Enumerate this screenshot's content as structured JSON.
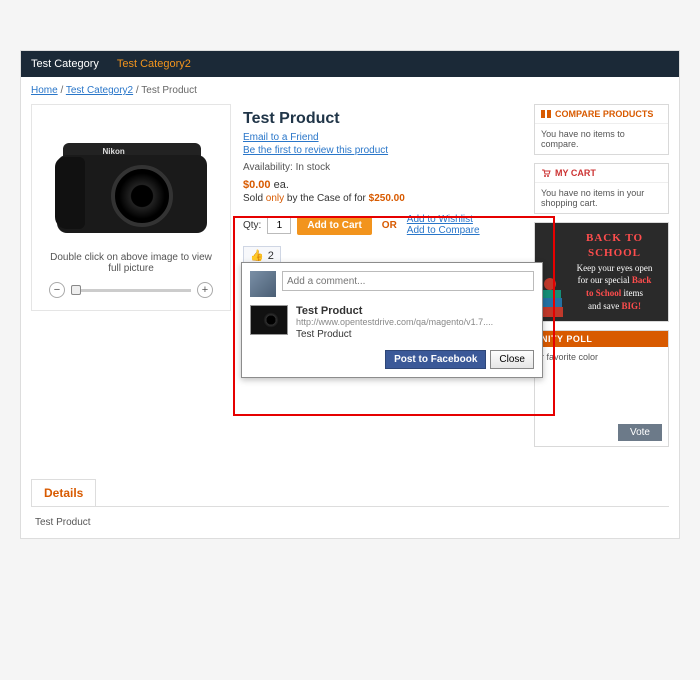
{
  "nav": {
    "cat1": "Test Category",
    "cat2": "Test Category2"
  },
  "breadcrumb": {
    "home": "Home",
    "cat": "Test Category2",
    "product": "Test Product"
  },
  "product": {
    "title": "Test Product",
    "email_friend": "Email to a Friend",
    "first_review": "Be the first to review this product",
    "availability": "Availability: In stock",
    "price_zero": "$0.00",
    "price_ea": " ea.",
    "sold_label": "Sold ",
    "only": "only",
    "by_case": " by the Case of for ",
    "case_price": "$250.00",
    "qty_label": "Qty:",
    "qty_value": "1",
    "add_to_cart": "Add to Cart",
    "or": "OR",
    "wishlist": "Add to Wishlist",
    "compare": "Add to Compare",
    "img_hint": "Double click on above image to view full picture",
    "camera_brand": "Nikon"
  },
  "like": {
    "count": "2",
    "like_label": "Like"
  },
  "fb": {
    "placeholder": "Add a comment...",
    "attach_title": "Test Product",
    "attach_url": "http://www.opentestdrive.com/qa/magento/v1.7....",
    "attach_desc": "Test Product",
    "post": "Post to Facebook",
    "close": "Close"
  },
  "sidebar": {
    "compare_title": "COMPARE PRODUCTS",
    "compare_body": "You have no items to compare.",
    "cart_title": "MY CART",
    "cart_body": "You have no items in your shopping cart.",
    "promo_title": "BACK TO SCHOOL",
    "promo_l1": "Keep your eyes open",
    "promo_l2a": "for our special ",
    "promo_l2b": "Back",
    "promo_l3a": "to School",
    "promo_l3b": " items",
    "promo_l4": "and save ",
    "promo_big": "BIG!",
    "poll_title": "NITY POLL",
    "poll_q": "r favorite color",
    "vote": "Vote"
  },
  "details": {
    "tab": "Details",
    "body": "Test Product"
  }
}
